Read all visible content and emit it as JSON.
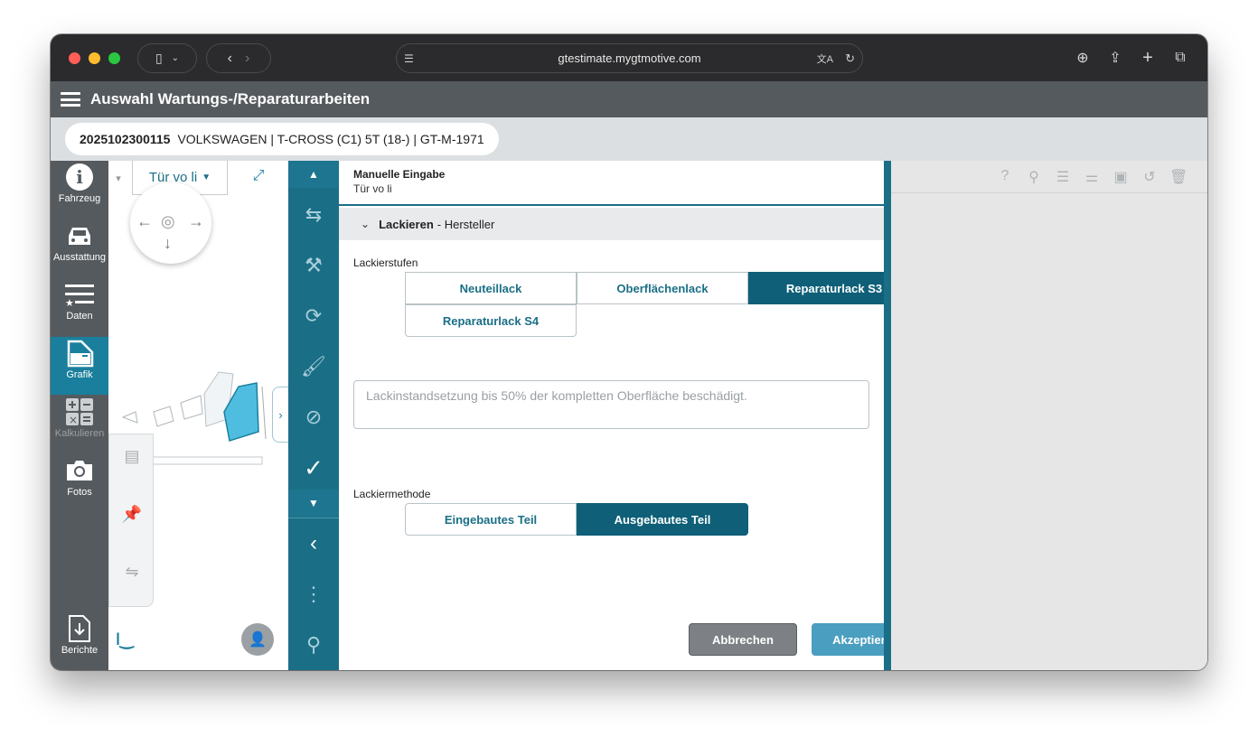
{
  "browser": {
    "url": "gtestimate.mygtmotive.com"
  },
  "app": {
    "title": "Auswahl Wartungs-/Reparaturarbeiten"
  },
  "vehicle": {
    "id": "2025102300115",
    "description": "VOLKSWAGEN | T-CROSS (C1) 5T (18-) | GT-M-1971"
  },
  "sidebar": {
    "items": [
      {
        "label": "Fahrzeug",
        "icon": "info-icon"
      },
      {
        "label": "Ausstattung",
        "icon": "car-icon"
      },
      {
        "label": "Daten",
        "icon": "list-star-icon"
      },
      {
        "label": "Grafik",
        "icon": "door-icon"
      },
      {
        "label": "Kalkulieren",
        "icon": "calculator-icon"
      },
      {
        "label": "Fotos",
        "icon": "camera-icon"
      },
      {
        "label": "Berichte",
        "icon": "download-file-icon"
      }
    ]
  },
  "graphic": {
    "door_selection": "Tür vo li"
  },
  "form": {
    "header_title": "Manuelle Eingabe",
    "header_subtitle": "Tür vo li",
    "section_title": "Lackieren",
    "section_suffix": "- Hersteller",
    "levels_label": "Lackierstufen",
    "levels": [
      "Neuteillack",
      "Oberflächenlack",
      "Reparaturlack S3",
      "Reparaturlack S4"
    ],
    "selected_level": "Reparaturlack S3",
    "description_placeholder": "Lackinstandsetzung bis 50% der kompletten Oberfläche beschädigt.",
    "method_label": "Lackiermethode",
    "methods": [
      "Eingebautes Teil",
      "Ausgebautes Teil"
    ],
    "selected_method": "Ausgebautes Teil",
    "cancel_label": "Abbrechen",
    "accept_label": "Akzeptieren"
  },
  "colors": {
    "accent": "#1a6f86",
    "selected": "#0e5f77",
    "accept": "#4a9ec0",
    "header": "#555a5e"
  }
}
